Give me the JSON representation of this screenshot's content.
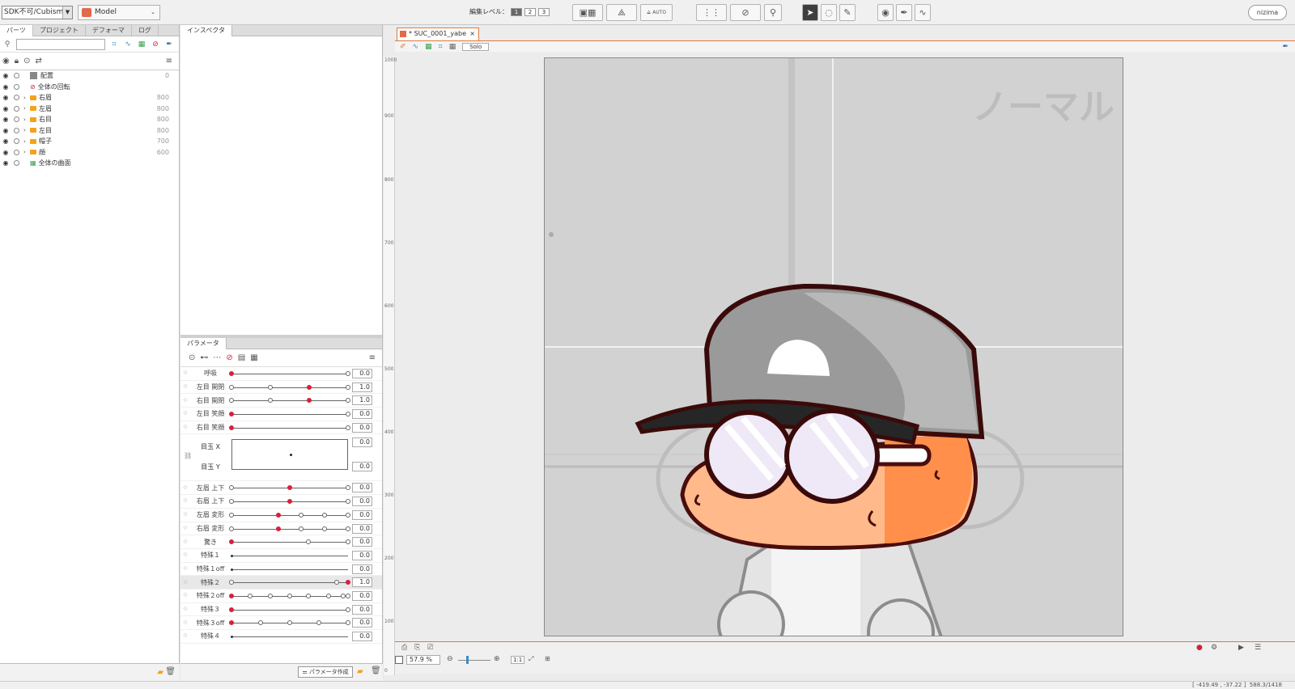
{
  "toolbar": {
    "sdk_select": "SDK不可/Cubism4.0",
    "model_select": "Model",
    "edit_level_label": "編集レベル：",
    "edit_levels": [
      "1",
      "2",
      "3"
    ],
    "auto_label": "AUTO",
    "brand": "nizima"
  },
  "left_panel": {
    "tabs": [
      "パーツ",
      "プロジェクト",
      "デフォーマ",
      "ログ"
    ],
    "tree": [
      {
        "label": "配置",
        "val": "0"
      },
      {
        "label": "全体の回転",
        "val": ""
      },
      {
        "label": "右眉",
        "val": "800"
      },
      {
        "label": "左眉",
        "val": "800"
      },
      {
        "label": "右目",
        "val": "800"
      },
      {
        "label": "左目",
        "val": "800"
      },
      {
        "label": "帽子",
        "val": "700"
      },
      {
        "label": "顔",
        "val": "600"
      },
      {
        "label": "全体の曲面",
        "val": ""
      }
    ]
  },
  "inspector": {
    "tab": "インスペクタ"
  },
  "params": {
    "tab": "パラメータ",
    "create_button": "パラメータ作成",
    "rows": [
      {
        "name": "呼吸",
        "value": "0.0"
      },
      {
        "name": "左目 開閉",
        "value": "1.0"
      },
      {
        "name": "右目 開閉",
        "value": "1.0"
      },
      {
        "name": "左目 笑顔",
        "value": "0.0"
      },
      {
        "name": "右目 笑顔",
        "value": "0.0"
      }
    ],
    "eye_x": {
      "name": "目玉 X",
      "value": "0.0"
    },
    "eye_y": {
      "name": "目玉 Y",
      "value": "0.0"
    },
    "rows2": [
      {
        "name": "左眉 上下",
        "value": "0.0"
      },
      {
        "name": "右眉 上下",
        "value": "0.0"
      },
      {
        "name": "左眉 変形",
        "value": "0.0"
      },
      {
        "name": "右眉 変形",
        "value": "0.0"
      },
      {
        "name": "驚き",
        "value": "0.0"
      },
      {
        "name": "特殊１",
        "value": "0.0"
      },
      {
        "name": "特殊１off",
        "value": "0.0"
      },
      {
        "name": "特殊２",
        "value": "1.0"
      },
      {
        "name": "特殊２off",
        "value": "0.0"
      },
      {
        "name": "特殊３",
        "value": "0.0"
      },
      {
        "name": "特殊３off",
        "value": "0.0"
      },
      {
        "name": "特殊４",
        "value": "0.0"
      }
    ]
  },
  "viewport": {
    "doc_tab": "* SUC_0001_yabe",
    "solo": "Solo",
    "ruler": [
      "1000",
      "900",
      "800",
      "700",
      "600",
      "500",
      "400",
      "300",
      "200",
      "100",
      "0"
    ],
    "canvas_text": "ノーマル",
    "zoom": "57.9 %",
    "one_to_one": "1:1"
  },
  "status": {
    "coords": "[ -419.49 , -37.22 ]",
    "extra": "588.3/1418"
  },
  "colors": {
    "accent": "#e07a3a",
    "key_red": "#d9203a",
    "folder": "#f4a21c"
  }
}
